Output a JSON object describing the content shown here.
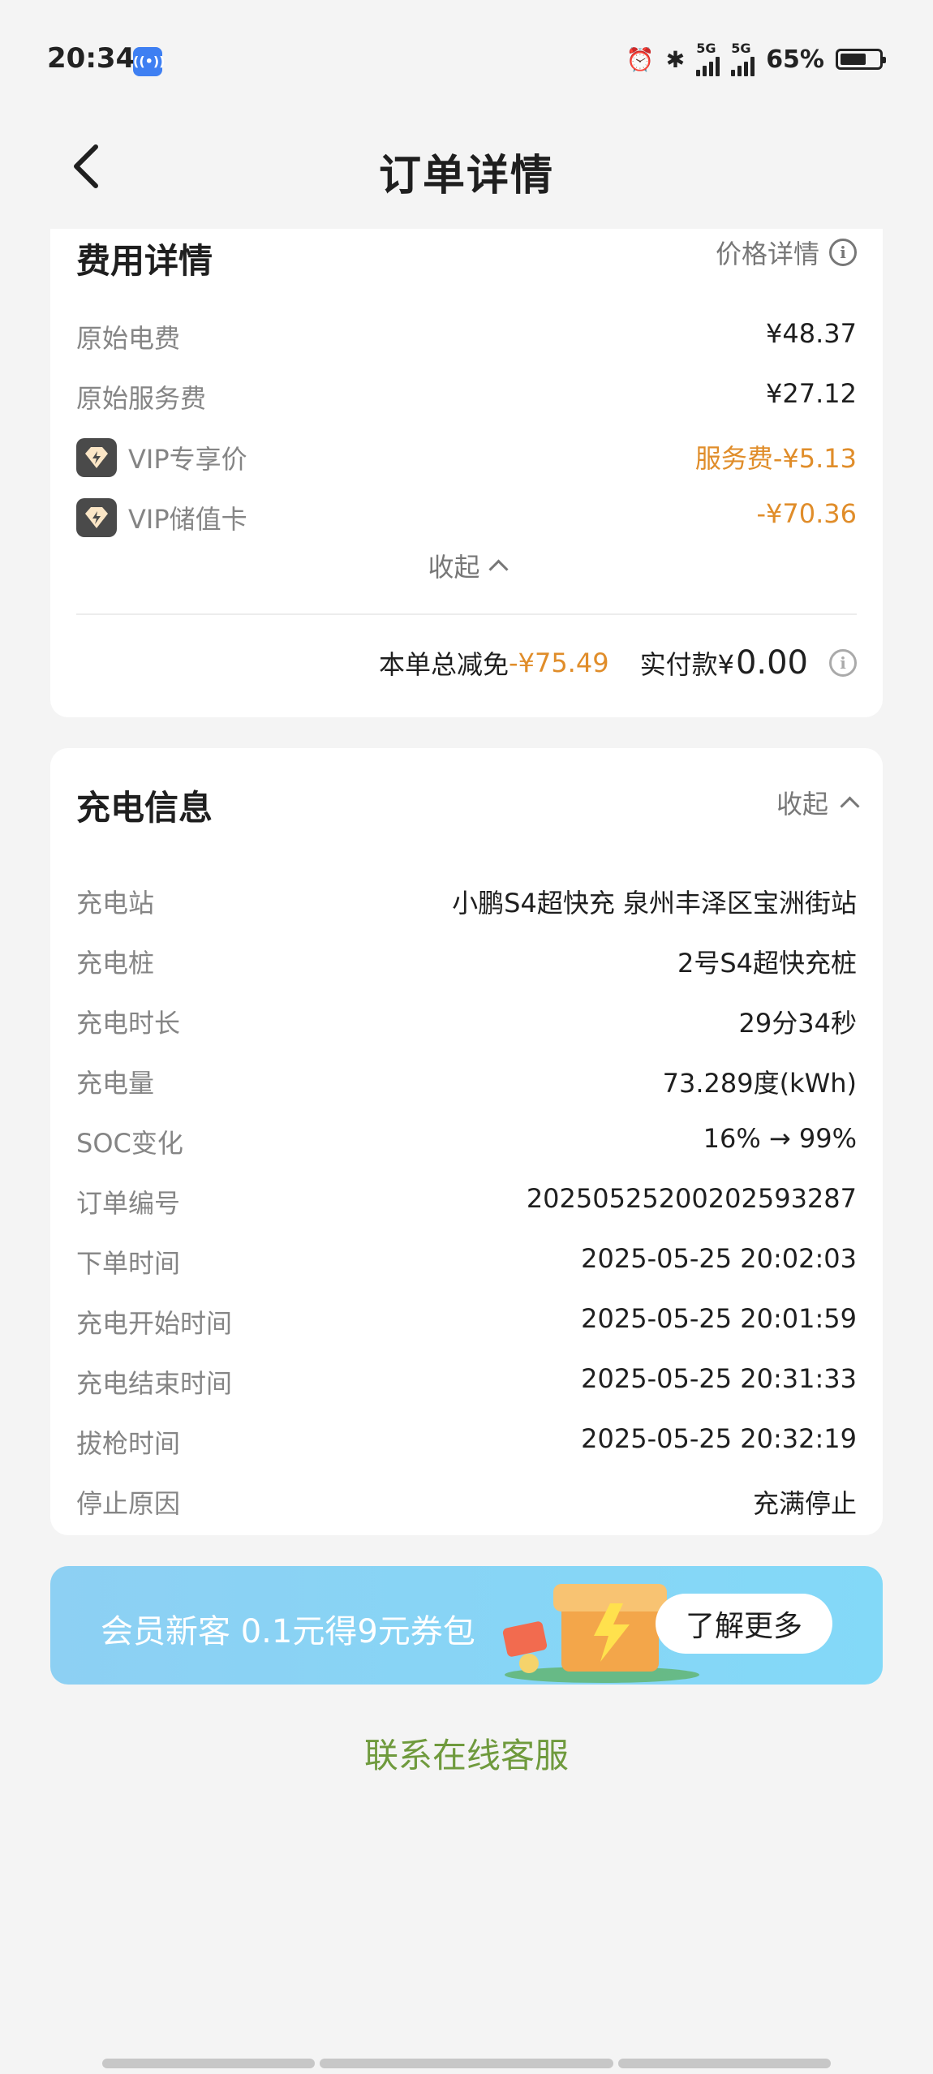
{
  "status_bar": {
    "time": "20:34",
    "nfc_badge": "((•))",
    "battery": "65%",
    "network_1": "5G",
    "network_2": "5G"
  },
  "header": {
    "title": "订单详情"
  },
  "fee_section": {
    "title": "费用详情",
    "price_detail_label": "价格详情",
    "rows": [
      {
        "label": "原始电费",
        "value": "¥48.37"
      },
      {
        "label": "原始服务费",
        "value": "¥27.12"
      },
      {
        "label": "VIP专享价",
        "value": "服务费-¥5.13"
      },
      {
        "label": "VIP储值卡",
        "value": "-¥70.36"
      }
    ],
    "collapse_label": "收起",
    "total_discount_label": "本单总减免",
    "total_discount_value": "-¥75.49",
    "paid_label": "实付款¥",
    "paid_value": "0.00"
  },
  "charge_section": {
    "title": "充电信息",
    "collapse_label": "收起",
    "rows": [
      {
        "label": "充电站",
        "value": "小鹏S4超快充 泉州丰泽区宝洲街站"
      },
      {
        "label": "充电桩",
        "value": "2号S4超快充桩"
      },
      {
        "label": "充电时长",
        "value": "29分34秒"
      },
      {
        "label": "充电量",
        "value": "73.289度(kWh)"
      },
      {
        "label": "SOC变化",
        "value": "16% → 99%"
      },
      {
        "label": "订单编号",
        "value": "20250525200202593287"
      },
      {
        "label": "下单时间",
        "value": "2025-05-25 20:02:03"
      },
      {
        "label": "充电开始时间",
        "value": "2025-05-25 20:01:59"
      },
      {
        "label": "充电结束时间",
        "value": "2025-05-25 20:31:33"
      },
      {
        "label": "拔枪时间",
        "value": "2025-05-25 20:32:19"
      },
      {
        "label": "停止原因",
        "value": "充满停止"
      }
    ]
  },
  "promo": {
    "text": "会员新客 0.1元得9元券包",
    "button_label": "了解更多"
  },
  "contact": {
    "label": "联系在线客服"
  },
  "colors": {
    "accent_orange": "#e08d2a",
    "contact_green": "#6f9a3d",
    "banner_blue": "#88d4f5"
  }
}
